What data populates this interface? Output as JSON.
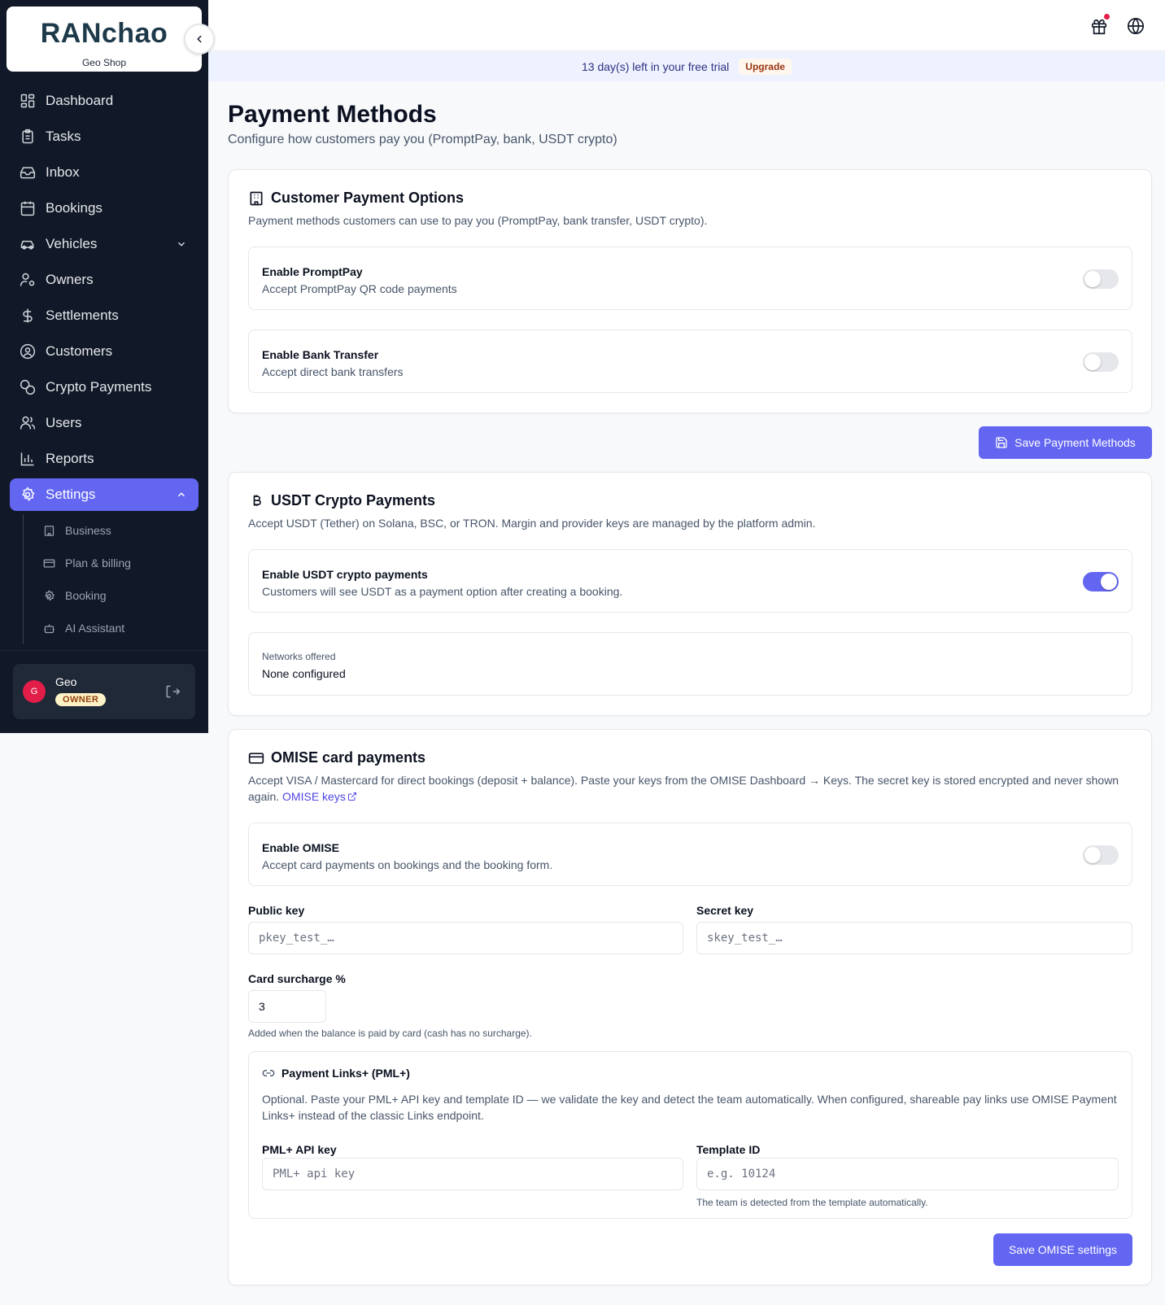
{
  "brand": {
    "logo": "RANchao",
    "shop_name": "Geo Shop"
  },
  "nav": [
    {
      "label": "Dashboard",
      "icon": "dashboard-icon"
    },
    {
      "label": "Tasks",
      "icon": "clipboard-icon"
    },
    {
      "label": "Inbox",
      "icon": "inbox-icon"
    },
    {
      "label": "Bookings",
      "icon": "calendar-icon"
    },
    {
      "label": "Vehicles",
      "icon": "car-icon"
    },
    {
      "label": "Owners",
      "icon": "user-cog-icon"
    },
    {
      "label": "Settlements",
      "icon": "dollar-icon"
    },
    {
      "label": "Customers",
      "icon": "user-circle-icon"
    },
    {
      "label": "Crypto Payments",
      "icon": "coins-icon"
    },
    {
      "label": "Users",
      "icon": "users-icon"
    },
    {
      "label": "Reports",
      "icon": "bar-chart-icon"
    },
    {
      "label": "Settings",
      "icon": "gear-icon"
    }
  ],
  "subnav": [
    {
      "label": "Business",
      "icon": "building-icon"
    },
    {
      "label": "Plan & billing",
      "icon": "credit-card-icon"
    },
    {
      "label": "Booking",
      "icon": "gear-icon"
    },
    {
      "label": "AI Assistant",
      "icon": "bot-icon"
    }
  ],
  "user": {
    "initial": "G",
    "name": "Geo",
    "role": "OWNER"
  },
  "trial": {
    "text": "13 day(s) left in your free trial",
    "upgrade": "Upgrade"
  },
  "page": {
    "title": "Payment Methods",
    "subtitle": "Configure how customers pay you (PromptPay, bank, USDT crypto)"
  },
  "customer_options": {
    "title": "Customer Payment Options",
    "desc": "Payment methods customers can use to pay you (PromptPay, bank transfer, USDT crypto).",
    "promptpay": {
      "title": "Enable PromptPay",
      "sub": "Accept PromptPay QR code payments",
      "enabled": false
    },
    "bank": {
      "title": "Enable Bank Transfer",
      "sub": "Accept direct bank transfers",
      "enabled": false
    },
    "save": "Save Payment Methods"
  },
  "usdt": {
    "title": "USDT Crypto Payments",
    "desc": "Accept USDT (Tether) on Solana, BSC, or TRON. Margin and provider keys are managed by the platform admin.",
    "toggle": {
      "title": "Enable USDT crypto payments",
      "sub": "Customers will see USDT as a payment option after creating a booking.",
      "enabled": true
    },
    "networks_label": "Networks offered",
    "networks_value": "None configured"
  },
  "omise": {
    "title": "OMISE card payments",
    "desc": "Accept VISA / Mastercard for direct bookings (deposit + balance). Paste your keys from the OMISE Dashboard → Keys. The secret key is stored encrypted and never shown again.",
    "link": "OMISE keys",
    "toggle": {
      "title": "Enable OMISE",
      "sub": "Accept card payments on bookings and the booking form.",
      "enabled": false
    },
    "public_key": {
      "label": "Public key",
      "placeholder": "pkey_test_…",
      "value": ""
    },
    "secret_key": {
      "label": "Secret key",
      "placeholder": "skey_test_…",
      "value": ""
    },
    "surcharge": {
      "label": "Card surcharge %",
      "value": "3",
      "hint": "Added when the balance is paid by card (cash has no surcharge)."
    },
    "pml": {
      "title": "Payment Links+ (PML+)",
      "desc": "Optional. Paste your PML+ API key and template ID — we validate the key and detect the team automatically. When configured, shareable pay links use OMISE Payment Links+ instead of the classic Links endpoint.",
      "api_key": {
        "label": "PML+ API key",
        "placeholder": "PML+ api key"
      },
      "template": {
        "label": "Template ID",
        "placeholder": "e.g. 10124",
        "hint": "The team is detected from the template automatically."
      }
    },
    "save": "Save OMISE settings"
  },
  "colors": {
    "accent": "#6366f1",
    "sidebar": "#111827",
    "danger": "#e11d48"
  }
}
